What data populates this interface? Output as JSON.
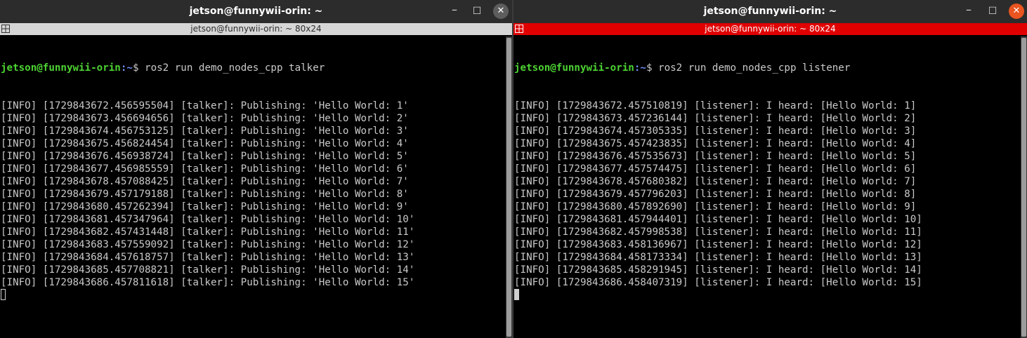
{
  "windows": [
    {
      "title": "jetson@funnywii-orin: ~",
      "tab_title": "jetson@funnywii-orin: ~ 80x24",
      "controls": {
        "minimize": "–",
        "maximize": "☐",
        "close": "✕"
      },
      "prompt": {
        "user_host": "jetson@funnywii-orin",
        "path": ":~",
        "symbol": "$",
        "command": " ros2 run demo_nodes_cpp talker"
      },
      "lines": [
        "[INFO] [1729843672.456595504] [talker]: Publishing: 'Hello World: 1'",
        "[INFO] [1729843673.456694656] [talker]: Publishing: 'Hello World: 2'",
        "[INFO] [1729843674.456753125] [talker]: Publishing: 'Hello World: 3'",
        "[INFO] [1729843675.456824454] [talker]: Publishing: 'Hello World: 4'",
        "[INFO] [1729843676.456938724] [talker]: Publishing: 'Hello World: 5'",
        "[INFO] [1729843677.456985559] [talker]: Publishing: 'Hello World: 6'",
        "[INFO] [1729843678.457088425] [talker]: Publishing: 'Hello World: 7'",
        "[INFO] [1729843679.457179188] [talker]: Publishing: 'Hello World: 8'",
        "[INFO] [1729843680.457262394] [talker]: Publishing: 'Hello World: 9'",
        "[INFO] [1729843681.457347964] [talker]: Publishing: 'Hello World: 10'",
        "[INFO] [1729843682.457431448] [talker]: Publishing: 'Hello World: 11'",
        "[INFO] [1729843683.457559092] [talker]: Publishing: 'Hello World: 12'",
        "[INFO] [1729843684.457618757] [talker]: Publishing: 'Hello World: 13'",
        "[INFO] [1729843685.457708821] [talker]: Publishing: 'Hello World: 14'",
        "[INFO] [1729843686.457811618] [talker]: Publishing: 'Hello World: 15'"
      ]
    },
    {
      "title": "jetson@funnywii-orin: ~",
      "tab_title": "jetson@funnywii-orin: ~ 80x24",
      "controls": {
        "minimize": "–",
        "maximize": "☐",
        "close": "✕"
      },
      "prompt": {
        "user_host": "jetson@funnywii-orin",
        "path": ":~",
        "symbol": "$",
        "command": " ros2 run demo_nodes_cpp listener"
      },
      "lines": [
        "[INFO] [1729843672.457510819] [listener]: I heard: [Hello World: 1]",
        "[INFO] [1729843673.457236144] [listener]: I heard: [Hello World: 2]",
        "[INFO] [1729843674.457305335] [listener]: I heard: [Hello World: 3]",
        "[INFO] [1729843675.457423835] [listener]: I heard: [Hello World: 4]",
        "[INFO] [1729843676.457535673] [listener]: I heard: [Hello World: 5]",
        "[INFO] [1729843677.457574475] [listener]: I heard: [Hello World: 6]",
        "[INFO] [1729843678.457680382] [listener]: I heard: [Hello World: 7]",
        "[INFO] [1729843679.457796203] [listener]: I heard: [Hello World: 8]",
        "[INFO] [1729843680.457892690] [listener]: I heard: [Hello World: 9]",
        "[INFO] [1729843681.457944401] [listener]: I heard: [Hello World: 10]",
        "[INFO] [1729843682.457998538] [listener]: I heard: [Hello World: 11]",
        "[INFO] [1729843683.458136967] [listener]: I heard: [Hello World: 12]",
        "[INFO] [1729843684.458173334] [listener]: I heard: [Hello World: 13]",
        "[INFO] [1729843685.458291945] [listener]: I heard: [Hello World: 14]",
        "[INFO] [1729843686.458407319] [listener]: I heard: [Hello World: 15]"
      ]
    }
  ],
  "colors": {
    "prompt_user": "#4cd232",
    "prompt_path": "#6f8cf0",
    "terminal_bg": "#000000",
    "terminal_fg": "#c9c9c9",
    "active_tab_bar": "#e00000",
    "inactive_tab_bar": "#d6d6d6",
    "close_active": "#e9541f"
  },
  "icons": {
    "tab_icon_left": "terminal-grid-icon",
    "tab_icon_right": "terminal-grid-icon",
    "minimize": "minimize-icon",
    "maximize": "maximize-icon",
    "close": "close-icon"
  }
}
